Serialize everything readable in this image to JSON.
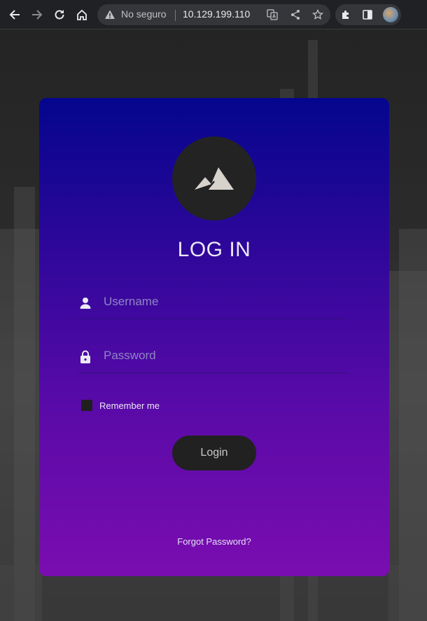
{
  "browser": {
    "security_label": "No seguro",
    "url": "10.129.199.110",
    "icons": [
      "back-icon",
      "forward-icon",
      "reload-icon",
      "home-icon",
      "warning-icon",
      "translate-icon",
      "share-icon",
      "star-icon",
      "extensions-icon",
      "sidepanel-icon",
      "avatar"
    ]
  },
  "login": {
    "title": "LOG IN",
    "username_placeholder": "Username",
    "password_placeholder": "Password",
    "remember_label": "Remember me",
    "login_label": "Login",
    "forgot_label": "Forgot Password?"
  },
  "colors": {
    "card_top": "#04068e",
    "card_bottom": "#7a0db0",
    "button_bg": "#212121",
    "logo_bg": "#232323"
  }
}
